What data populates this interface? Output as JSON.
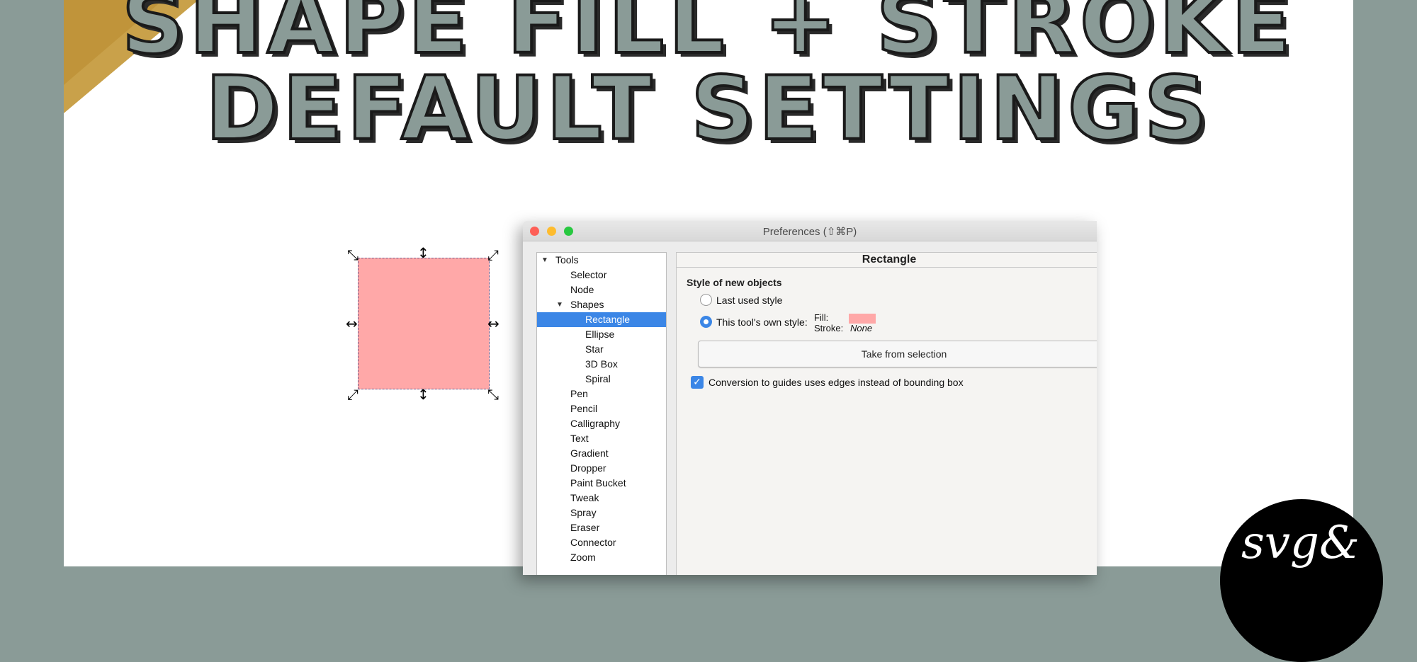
{
  "header": {
    "line1": "SHAPE FILL + STROKE",
    "line2": "DEFAULT SETTINGS"
  },
  "colors": {
    "background": "#8a9b97",
    "panel": "#ffffff",
    "shape_fill": "#ffa8a8",
    "selection_blue": "#3b86e6",
    "gold_accent": "#c9a14a"
  },
  "canvas": {
    "handle_corner_nw": "⤡",
    "handle_corner_ne": "⤢",
    "handle_corner_sw": "⤢",
    "handle_corner_se": "⤡",
    "handle_vertical": "↕",
    "handle_horizontal": "↔"
  },
  "window": {
    "title": "Preferences (⇧⌘P)"
  },
  "tree": {
    "items": [
      {
        "label": "Tools"
      },
      {
        "label": "Selector"
      },
      {
        "label": "Node"
      },
      {
        "label": "Shapes"
      },
      {
        "label": "Rectangle"
      },
      {
        "label": "Ellipse"
      },
      {
        "label": "Star"
      },
      {
        "label": "3D Box"
      },
      {
        "label": "Spiral"
      },
      {
        "label": "Pen"
      },
      {
        "label": "Pencil"
      },
      {
        "label": "Calligraphy"
      },
      {
        "label": "Text"
      },
      {
        "label": "Gradient"
      },
      {
        "label": "Dropper"
      },
      {
        "label": "Paint Bucket"
      },
      {
        "label": "Tweak"
      },
      {
        "label": "Spray"
      },
      {
        "label": "Eraser"
      },
      {
        "label": "Connector"
      },
      {
        "label": "Zoom"
      }
    ]
  },
  "content": {
    "heading": "Rectangle",
    "section_title": "Style of new objects",
    "option_last_used": "Last used style",
    "option_own_style": "This tool's own style:",
    "fill_label": "Fill:",
    "stroke_label": "Stroke:",
    "stroke_value": "None",
    "take_button": "Take from selection",
    "checkbox_label": "Conversion to guides uses edges instead of bounding box"
  },
  "logo": {
    "text": "svg&"
  }
}
